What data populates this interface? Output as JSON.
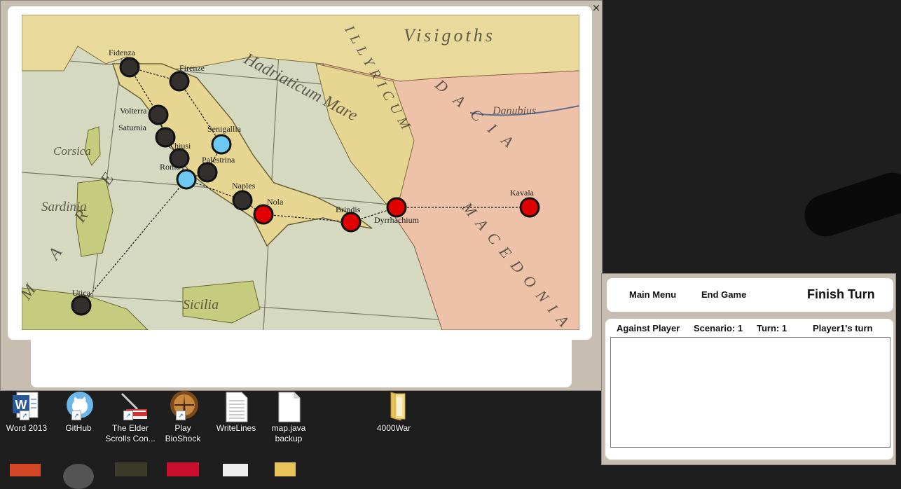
{
  "window": {
    "close_label": "×"
  },
  "map": {
    "sea_labels": [
      "Hadriaticum Mare",
      "ILLYRICUM",
      "Visigoths",
      "DACIA",
      "MACEDONIA",
      "Danubius",
      "Corsica",
      "Sardinia",
      "Sicilia",
      "MARE"
    ],
    "cities": [
      {
        "name": "Fidenza",
        "owner": "neutral"
      },
      {
        "name": "Firenze",
        "owner": "neutral"
      },
      {
        "name": "Volterra",
        "owner": "neutral"
      },
      {
        "name": "Saturnia",
        "owner": "neutral"
      },
      {
        "name": "Senigallia",
        "owner": "player2"
      },
      {
        "name": "Chiusi",
        "owner": "neutral"
      },
      {
        "name": "Palestrina",
        "owner": "neutral"
      },
      {
        "name": "Roma",
        "owner": "player2"
      },
      {
        "name": "Naples",
        "owner": "neutral"
      },
      {
        "name": "Nola",
        "owner": "player1"
      },
      {
        "name": "Brindis",
        "owner": "player1"
      },
      {
        "name": "Dyrrhachium",
        "owner": "player1"
      },
      {
        "name": "Kavala",
        "owner": "player1"
      },
      {
        "name": "Utica",
        "owner": "neutral"
      }
    ],
    "colors": {
      "neutral": "#332f2d",
      "player1": "#e10000",
      "player2": "#6cc9f4"
    }
  },
  "controls": {
    "main_menu": "Main Menu",
    "end_game": "End Game",
    "finish_turn": "Finish Turn"
  },
  "status": {
    "mode": "Against Player",
    "scenario": "Scenario: 1",
    "turn": "Turn: 1",
    "current_player": "Player1's turn"
  },
  "log": {
    "text": ""
  },
  "desktop_icons": [
    {
      "label": "Word 2013",
      "icon": "word-icon"
    },
    {
      "label": "GitHub",
      "icon": "github-icon"
    },
    {
      "label": "The Elder Scrolls Con...",
      "icon": "elder-scrolls-icon"
    },
    {
      "label": "Play BioShock",
      "icon": "bioshock-icon"
    },
    {
      "label": "WriteLines",
      "icon": "text-file-icon"
    },
    {
      "label": "map.java backup",
      "icon": "blank-file-icon"
    },
    {
      "label": "4000War",
      "icon": "folder-icon"
    }
  ]
}
